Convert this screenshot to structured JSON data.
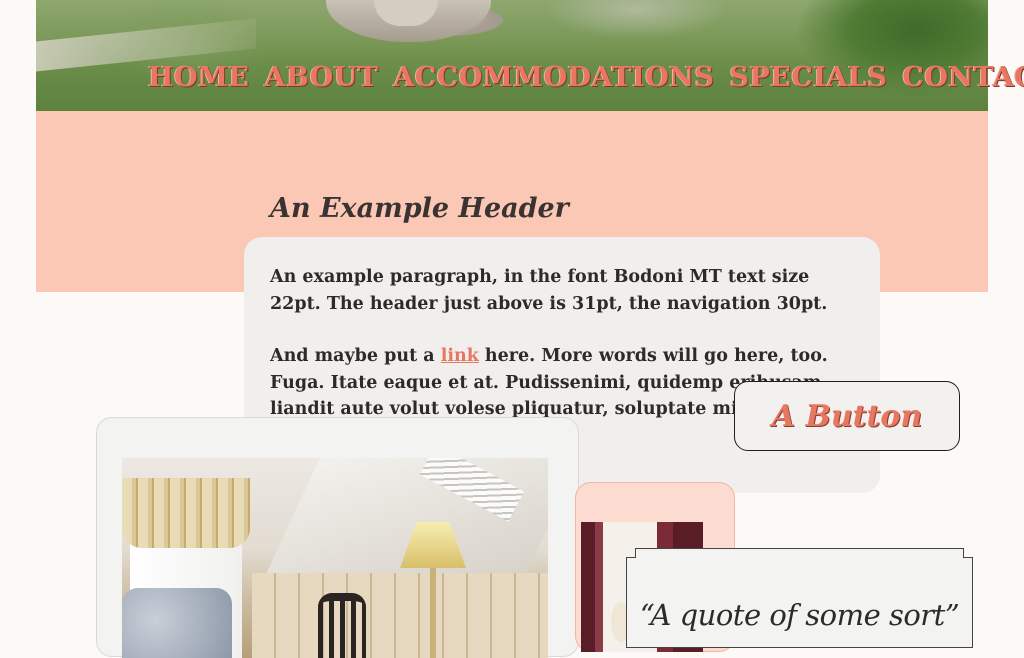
{
  "nav": {
    "items": [
      {
        "label": "HOME"
      },
      {
        "label": "ABOUT"
      },
      {
        "label": "ACCOMMODATIONS"
      },
      {
        "label": "SPECIALS"
      },
      {
        "label": "CONTACT"
      }
    ]
  },
  "content": {
    "heading": "An Example Header",
    "paragraph1": "An example paragraph, in the font Bodoni MT text size 22pt. The header just above is 31pt, the navigation 30pt.",
    "paragraph2_before": "And maybe put a ",
    "link_text": "link",
    "paragraph2_after": " here. More words will go here, too. Fuga. Itate eaque et at. Pudissenimi, quidemp erihusam liandit aute volut volese pliquatur, soluptate mi rerferentia nonse lit"
  },
  "button": {
    "label": "A Button"
  },
  "quote": {
    "text": "“A quote of some sort”"
  },
  "colors": {
    "accent": "#e87761",
    "band": "#fac8b5",
    "card": "#f1efed",
    "text": "#2e2a28"
  }
}
